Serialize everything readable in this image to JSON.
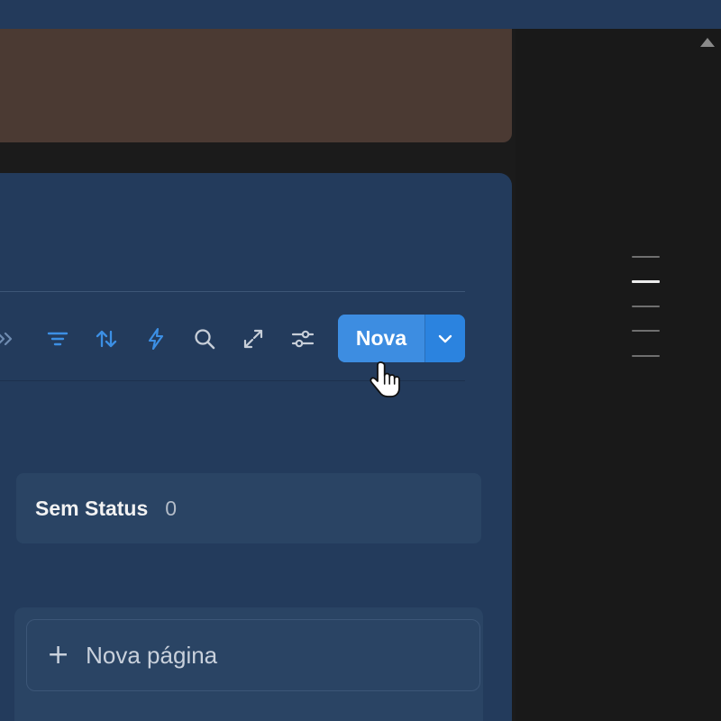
{
  "toolbar": {
    "new_label": "Nova",
    "icons": [
      "collapse-chevrons-icon",
      "filter-icon",
      "sort-icon",
      "automation-bolt-icon",
      "search-icon",
      "expand-icon",
      "settings-sliders-icon",
      "chevron-down-icon"
    ]
  },
  "board": {
    "group": {
      "title": "Sem Status",
      "count": "0"
    },
    "add_page_label": "Nova página",
    "add_page_icon": "plus-icon"
  },
  "colors": {
    "accent": "#2383e2",
    "panel": "#233b5c",
    "cover": "#4b3a33",
    "sidebar": "#191919"
  }
}
